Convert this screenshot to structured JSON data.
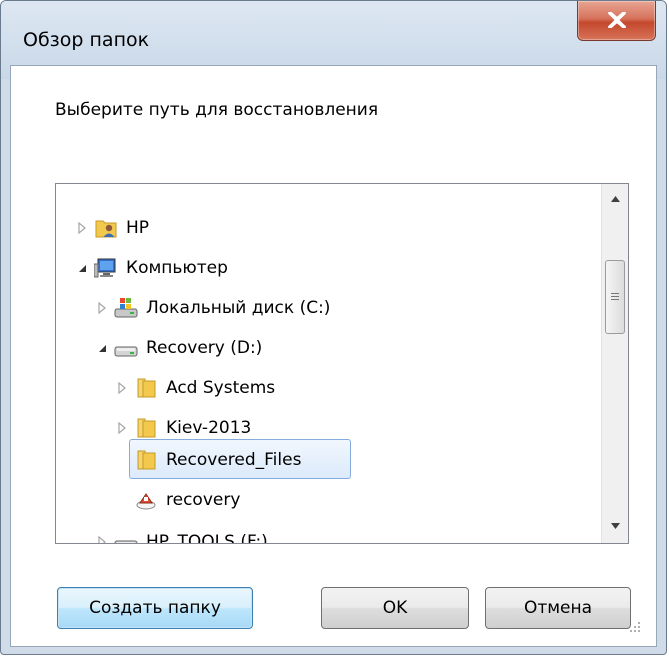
{
  "window": {
    "title": "Обзор папок",
    "close_icon": "close-x-icon"
  },
  "prompt": "Выберите путь для восстановления",
  "tree": {
    "items": [
      {
        "label": "HP",
        "icon": "user-folder-icon",
        "expander": "collapsed",
        "level": 0
      },
      {
        "label": "Компьютер",
        "icon": "computer-icon",
        "expander": "expanded",
        "level": 0
      },
      {
        "label": "Локальный диск (C:)",
        "icon": "windows-drive-icon",
        "expander": "collapsed",
        "level": 1
      },
      {
        "label": "Recovery (D:)",
        "icon": "drive-icon",
        "expander": "expanded",
        "level": 1
      },
      {
        "label": "Acd Systems",
        "icon": "folder-icon",
        "expander": "collapsed",
        "level": 2
      },
      {
        "label": "Kiev-2013",
        "icon": "folder-icon",
        "expander": "collapsed",
        "level": 2
      },
      {
        "label": "Recovered_Files",
        "icon": "folder-icon",
        "expander": "none",
        "level": 2,
        "selected": true
      },
      {
        "label": "recovery",
        "icon": "recovery-icon",
        "expander": "none",
        "level": 2
      },
      {
        "label": "HP_TOOLS (F:)",
        "icon": "drive-icon",
        "expander": "collapsed",
        "level": 1
      }
    ]
  },
  "buttons": {
    "new_folder": "Создать папку",
    "ok": "OK",
    "cancel": "Отмена"
  },
  "colors": {
    "close_button": "#c4482c",
    "selection_border": "#84acdd",
    "folder_yellow": "#f2c94c"
  }
}
